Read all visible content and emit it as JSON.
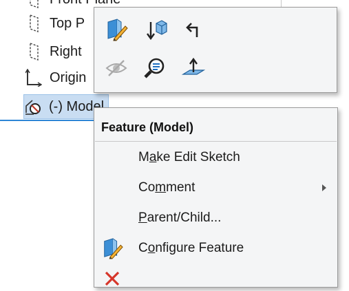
{
  "tree": {
    "items": [
      {
        "label": "Front Plane",
        "icon": "plane-icon"
      },
      {
        "label": "Top P",
        "icon": "plane-icon"
      },
      {
        "label": "Right",
        "icon": "plane-icon"
      },
      {
        "label": "Origin",
        "icon": "origin-icon"
      },
      {
        "label": "(-) Model",
        "icon": "sketch-icon",
        "selected": true
      }
    ]
  },
  "toolbar": {
    "buttons": [
      {
        "name": "edit-feature",
        "icon": "edit-feature-icon"
      },
      {
        "name": "rollback",
        "icon": "rollback-icon"
      },
      {
        "name": "parent",
        "icon": "parent-arrow-icon"
      },
      {
        "name": "hide",
        "icon": "eye-slash-icon"
      },
      {
        "name": "zoom-to-selection",
        "icon": "zoom-icon"
      },
      {
        "name": "normal-to",
        "icon": "normal-to-icon"
      }
    ]
  },
  "menu": {
    "title": "Feature (Model)",
    "items": [
      {
        "pre": "M",
        "u": "a",
        "post": "ke Edit Sketch",
        "submenu": false
      },
      {
        "pre": "Co",
        "u": "m",
        "post": "ment",
        "submenu": true
      },
      {
        "pre": "",
        "u": "P",
        "post": "arent/Child...",
        "submenu": false
      },
      {
        "pre": "C",
        "u": "o",
        "post": "nfigure Feature",
        "submenu": false,
        "icon": "configure-feature-icon"
      }
    ]
  },
  "colors": {
    "selection": "#c9ddf2",
    "accent": "#2e86d6",
    "panel": "#f4f5f6"
  }
}
